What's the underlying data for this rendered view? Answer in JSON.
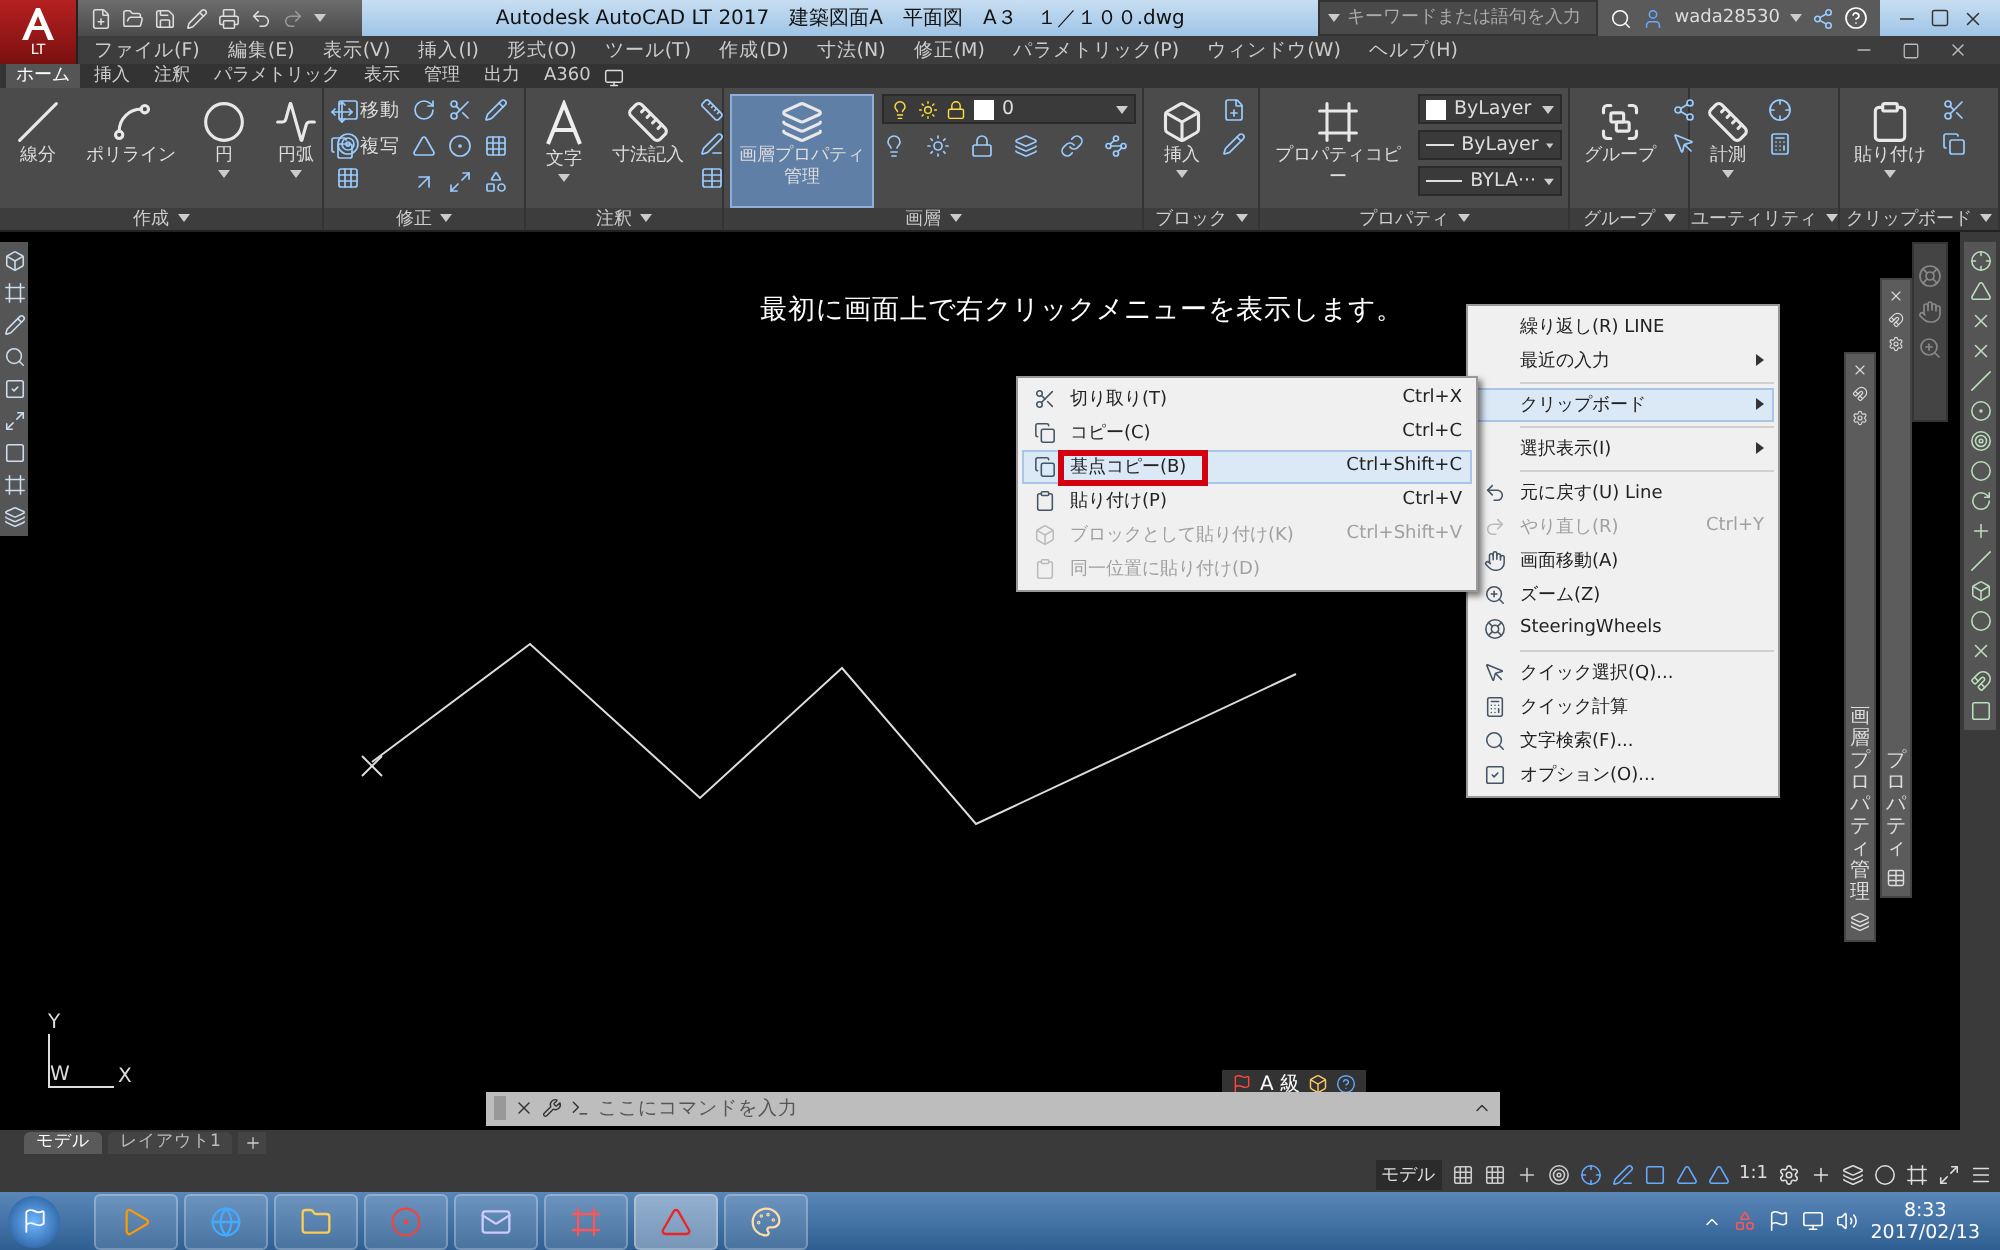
{
  "title_bar": {
    "app_badge": "LT",
    "title": "Autodesk AutoCAD LT 2017　建築図面A　平面図　A３　１／１００.dwg",
    "search": {
      "placeholder": "キーワードまたは語句を入力"
    },
    "user": "wada28530"
  },
  "menu_bar": [
    "ファイル(F)",
    "編集(E)",
    "表示(V)",
    "挿入(I)",
    "形式(O)",
    "ツール(T)",
    "作成(D)",
    "寸法(N)",
    "修正(M)",
    "パラメトリック(P)",
    "ウィンドウ(W)",
    "ヘルプ(H)"
  ],
  "ribbon": {
    "tabs": [
      {
        "label": "ホーム",
        "selected": true
      },
      {
        "label": "挿入",
        "selected": false
      },
      {
        "label": "注釈",
        "selected": false
      },
      {
        "label": "パラメトリック",
        "selected": false
      },
      {
        "label": "表示",
        "selected": false
      },
      {
        "label": "管理",
        "selected": false
      },
      {
        "label": "出力",
        "selected": false
      },
      {
        "label": "A360",
        "selected": false
      }
    ],
    "panels": [
      {
        "title": "作成",
        "tools": [
          {
            "kind": "large",
            "label": "線分",
            "dropdown": false,
            "highlighted": false
          },
          {
            "kind": "large",
            "label": "ポリライン",
            "dropdown": false,
            "highlighted": false
          },
          {
            "kind": "large",
            "label": "円",
            "dropdown": true,
            "highlighted": false
          },
          {
            "kind": "large",
            "label": "円弧",
            "dropdown": true,
            "highlighted": false
          }
        ]
      },
      {
        "title": "修正",
        "tools": [
          {
            "kind": "small",
            "label": "移動"
          },
          {
            "kind": "small",
            "label": "複写"
          }
        ]
      },
      {
        "title": "注釈",
        "tools": [
          {
            "kind": "large",
            "label": "文字",
            "dropdown": true,
            "highlighted": false
          },
          {
            "kind": "large",
            "label": "寸法記入",
            "dropdown": false,
            "highlighted": false
          }
        ]
      },
      {
        "title": "画層",
        "tools": [
          {
            "kind": "large",
            "label": "画層プロパティ管理",
            "dropdown": false,
            "highlighted": true
          },
          {
            "kind": "combo",
            "value": "0"
          }
        ]
      },
      {
        "title": "ブロック",
        "tools": [
          {
            "kind": "large",
            "label": "挿入",
            "dropdown": true,
            "highlighted": false
          }
        ]
      },
      {
        "title": "プロパティ",
        "tools": [
          {
            "kind": "large",
            "label": "プロパティコピー",
            "dropdown": false,
            "highlighted": false
          },
          {
            "kind": "color_combo",
            "value": "ByLayer"
          },
          {
            "kind": "line_combo",
            "value": "ByLayer"
          },
          {
            "kind": "line_combo",
            "value": "BYLA···"
          }
        ]
      },
      {
        "title": "グループ",
        "tools": [
          {
            "kind": "large",
            "label": "グループ",
            "dropdown": false,
            "highlighted": false
          }
        ]
      },
      {
        "title": "ユーティリティ",
        "tools": [
          {
            "kind": "large",
            "label": "計測",
            "dropdown": true,
            "highlighted": false
          }
        ]
      },
      {
        "title": "クリップボード",
        "tools": [
          {
            "kind": "large",
            "label": "貼り付け",
            "dropdown": true,
            "highlighted": false
          }
        ]
      }
    ]
  },
  "drawing": {
    "note": "最初に画面上で右クリックメニューを表示します。",
    "ucs": {
      "y": "Y",
      "w": "W",
      "x": "X"
    },
    "context_menu": {
      "items": [
        {
          "kind": "item",
          "label": "繰り返し(R) LINE",
          "submenu": false,
          "disabled": false,
          "selected": false
        },
        {
          "kind": "item",
          "label": "最近の入力",
          "submenu": true,
          "disabled": false,
          "selected": false
        },
        {
          "kind": "separator"
        },
        {
          "kind": "item",
          "label": "クリップボード",
          "submenu": true,
          "disabled": false,
          "selected": true
        },
        {
          "kind": "separator"
        },
        {
          "kind": "item",
          "label": "選択表示(I)",
          "submenu": true,
          "disabled": false,
          "selected": false
        },
        {
          "kind": "separator"
        },
        {
          "kind": "item",
          "label": "元に戻す(U) Line",
          "submenu": false,
          "disabled": false,
          "selected": false
        },
        {
          "kind": "item",
          "label": "やり直し(R)",
          "shortcut": "Ctrl+Y",
          "submenu": false,
          "disabled": true,
          "selected": false
        },
        {
          "kind": "item",
          "label": "画面移動(A)",
          "submenu": false,
          "disabled": false,
          "selected": false
        },
        {
          "kind": "item",
          "label": "ズーム(Z)",
          "submenu": false,
          "disabled": false,
          "selected": false
        },
        {
          "kind": "item",
          "label": "SteeringWheels",
          "submenu": false,
          "disabled": false,
          "selected": false
        },
        {
          "kind": "separator"
        },
        {
          "kind": "item",
          "label": "クイック選択(Q)...",
          "submenu": false,
          "disabled": false,
          "selected": false
        },
        {
          "kind": "item",
          "label": "クイック計算",
          "submenu": false,
          "disabled": false,
          "selected": false
        },
        {
          "kind": "item",
          "label": "文字検索(F)...",
          "submenu": false,
          "disabled": false,
          "selected": false
        },
        {
          "kind": "item",
          "label": "オプション(O)...",
          "submenu": false,
          "disabled": false,
          "selected": false
        }
      ]
    },
    "submenu": {
      "items": [
        {
          "label": "切り取り(T)",
          "shortcut": "Ctrl+X",
          "disabled": false,
          "selected": false,
          "boxed": false
        },
        {
          "label": "コピー(C)",
          "shortcut": "Ctrl+C",
          "disabled": false,
          "selected": false,
          "boxed": false
        },
        {
          "label": "基点コピー(B)",
          "shortcut": "Ctrl+Shift+C",
          "disabled": false,
          "selected": true,
          "boxed": true
        },
        {
          "label": "貼り付け(P)",
          "shortcut": "Ctrl+V",
          "disabled": false,
          "selected": false,
          "boxed": false
        },
        {
          "label": "ブロックとして貼り付け(K)",
          "shortcut": "Ctrl+Shift+V",
          "disabled": true,
          "selected": false,
          "boxed": false
        },
        {
          "label": "同一位置に貼り付け(D)",
          "disabled": true,
          "selected": false,
          "boxed": false
        }
      ]
    },
    "palettes": [
      {
        "title": "画層プロパティ管理"
      },
      {
        "title": "プロパティ"
      }
    ],
    "command_line": {
      "placeholder": "ここにコマンドを入力"
    },
    "mini_toolbar": {
      "label": "A 級"
    }
  },
  "layout_tabs": [
    {
      "label": "モデル",
      "selected": true
    },
    {
      "label": "レイアウト1",
      "selected": false
    }
  ],
  "status_bar": {
    "mode": "モデル",
    "scale": "1:1"
  },
  "taskbar": {
    "time": "8:33",
    "date": "2017/02/13"
  }
}
